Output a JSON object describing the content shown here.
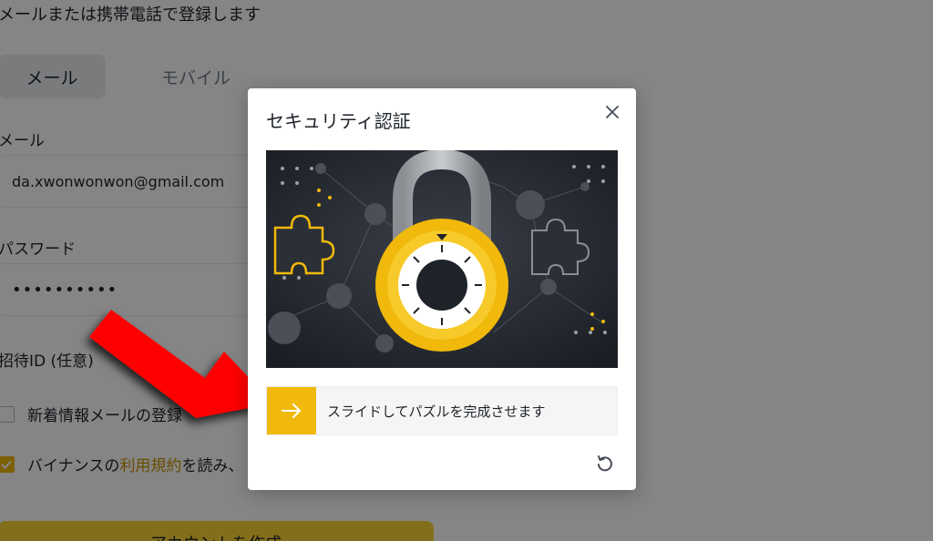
{
  "page": {
    "heading": "メールまたは携帯電話で登録します",
    "tabs": [
      {
        "label": "メール"
      },
      {
        "label": "モバイル"
      }
    ],
    "email": {
      "label": "メール",
      "value": "da.xwonwonwon@gmail.com"
    },
    "password": {
      "label": "パスワード",
      "value": "••••••••••"
    },
    "referral": {
      "label": "招待ID (任意)"
    },
    "newsletter": {
      "label": "新着情報メールの登録",
      "checked": false
    },
    "terms": {
      "prefix": "バイナンスの",
      "link": "利用規約",
      "suffix": "を読み、",
      "checked": true
    },
    "submit_label": "アカウントを作成"
  },
  "modal": {
    "title": "セキュリティ認証",
    "slider_text": "スライドしてパズルを完成させます",
    "icons": {
      "close": "close-icon",
      "slider_arrow": "arrow-right-icon",
      "refresh": "refresh-icon",
      "lock": "padlock-icon"
    }
  },
  "colors": {
    "accent": "#f0b90b",
    "link": "#c99400",
    "annotation_arrow": "#ff0000"
  }
}
